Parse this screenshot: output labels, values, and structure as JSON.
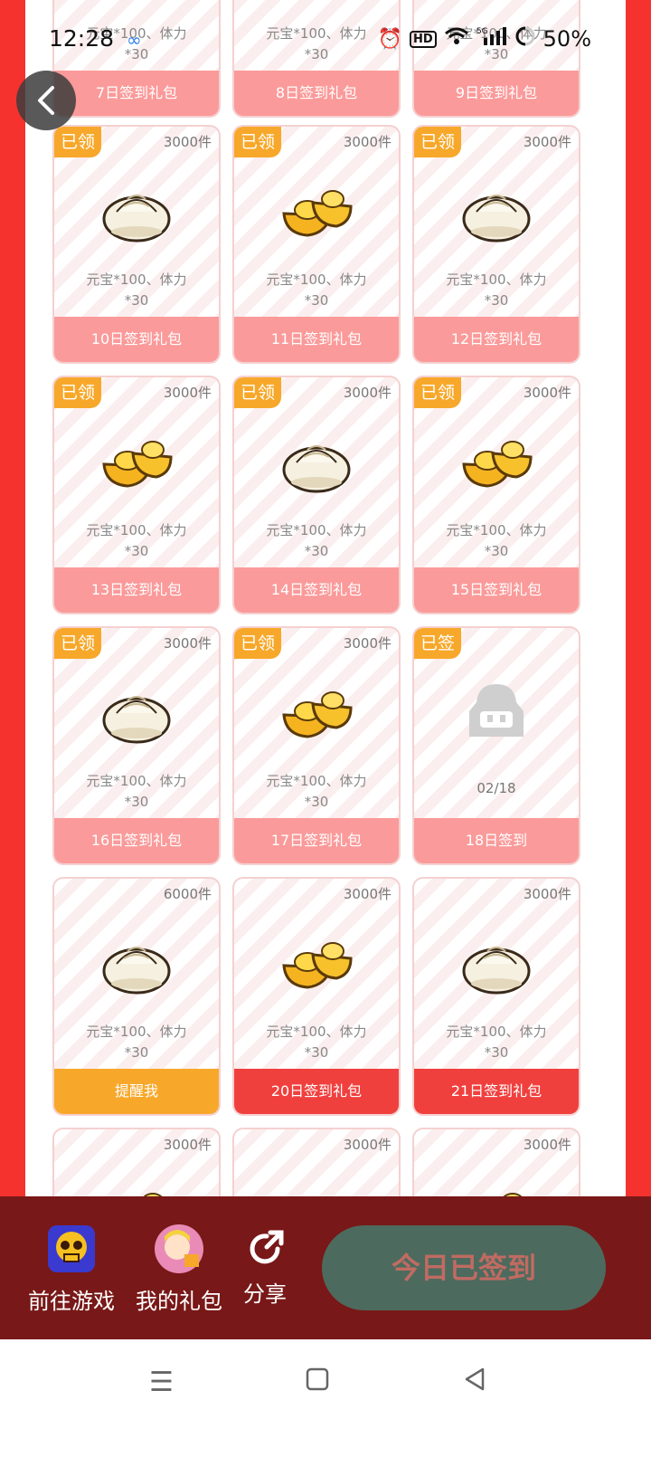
{
  "status_bar": {
    "time": "12:28",
    "battery": "50%"
  },
  "colors": {
    "frame_red": "#f5322e",
    "bar_pink": "#fb9a9a",
    "bar_orange": "#f7a82a",
    "bar_red": "#f0403e",
    "bottom_bar": "#791818",
    "checkin_bg": "#4d6a5e"
  },
  "cards": [
    {
      "badge": "",
      "stock": "",
      "desc1": "元宝*100、体力",
      "desc2": "*30",
      "date": "",
      "button": "7日签到礼包",
      "item": "bun",
      "btn_style": "pink",
      "partial": "top"
    },
    {
      "badge": "",
      "stock": "",
      "desc1": "元宝*100、体力",
      "desc2": "*30",
      "date": "",
      "button": "8日签到礼包",
      "item": "gold",
      "btn_style": "pink",
      "partial": "top"
    },
    {
      "badge": "",
      "stock": "",
      "desc1": "元宝*100、体力",
      "desc2": "*30",
      "date": "",
      "button": "9日签到礼包",
      "item": "bun",
      "btn_style": "pink",
      "partial": "top"
    },
    {
      "badge": "已领",
      "stock": "3000件",
      "desc1": "元宝*100、体力",
      "desc2": "*30",
      "date": "",
      "button": "10日签到礼包",
      "item": "bun",
      "btn_style": "pink"
    },
    {
      "badge": "已领",
      "stock": "3000件",
      "desc1": "元宝*100、体力",
      "desc2": "*30",
      "date": "",
      "button": "11日签到礼包",
      "item": "gold",
      "btn_style": "pink"
    },
    {
      "badge": "已领",
      "stock": "3000件",
      "desc1": "元宝*100、体力",
      "desc2": "*30",
      "date": "",
      "button": "12日签到礼包",
      "item": "bun",
      "btn_style": "pink"
    },
    {
      "badge": "已领",
      "stock": "3000件",
      "desc1": "元宝*100、体力",
      "desc2": "*30",
      "date": "",
      "button": "13日签到礼包",
      "item": "gold",
      "btn_style": "pink"
    },
    {
      "badge": "已领",
      "stock": "3000件",
      "desc1": "元宝*100、体力",
      "desc2": "*30",
      "date": "",
      "button": "14日签到礼包",
      "item": "bun",
      "btn_style": "pink"
    },
    {
      "badge": "已领",
      "stock": "3000件",
      "desc1": "元宝*100、体力",
      "desc2": "*30",
      "date": "",
      "button": "15日签到礼包",
      "item": "gold",
      "btn_style": "pink"
    },
    {
      "badge": "已领",
      "stock": "3000件",
      "desc1": "元宝*100、体力",
      "desc2": "*30",
      "date": "",
      "button": "16日签到礼包",
      "item": "bun",
      "btn_style": "pink"
    },
    {
      "badge": "已领",
      "stock": "3000件",
      "desc1": "元宝*100、体力",
      "desc2": "*30",
      "date": "",
      "button": "17日签到礼包",
      "item": "gold",
      "btn_style": "pink"
    },
    {
      "badge": "已签",
      "stock": "",
      "desc1": "",
      "desc2": "",
      "date": "02/18",
      "button": "18日签到",
      "item": "avatar",
      "btn_style": "pink"
    },
    {
      "badge": "",
      "stock": "6000件",
      "desc1": "元宝*100、体力",
      "desc2": "*30",
      "date": "",
      "button": "提醒我",
      "item": "bun",
      "btn_style": "orange"
    },
    {
      "badge": "",
      "stock": "3000件",
      "desc1": "元宝*100、体力",
      "desc2": "*30",
      "date": "",
      "button": "20日签到礼包",
      "item": "gold",
      "btn_style": "red"
    },
    {
      "badge": "",
      "stock": "3000件",
      "desc1": "元宝*100、体力",
      "desc2": "*30",
      "date": "",
      "button": "21日签到礼包",
      "item": "bun",
      "btn_style": "red"
    },
    {
      "badge": "",
      "stock": "3000件",
      "desc1": "",
      "desc2": "",
      "date": "",
      "button": "",
      "item": "gold",
      "btn_style": "none",
      "partial": "bottom"
    },
    {
      "badge": "",
      "stock": "3000件",
      "desc1": "",
      "desc2": "",
      "date": "",
      "button": "",
      "item": "bun",
      "btn_style": "none",
      "partial": "bottom"
    },
    {
      "badge": "",
      "stock": "3000件",
      "desc1": "",
      "desc2": "",
      "date": "",
      "button": "",
      "item": "gold",
      "btn_style": "none",
      "partial": "bottom"
    }
  ],
  "bottom_bar": {
    "go_game_label": "前往游戏",
    "my_gifts_label": "我的礼包",
    "share_label": "分享",
    "checkin_label": "今日已签到"
  }
}
